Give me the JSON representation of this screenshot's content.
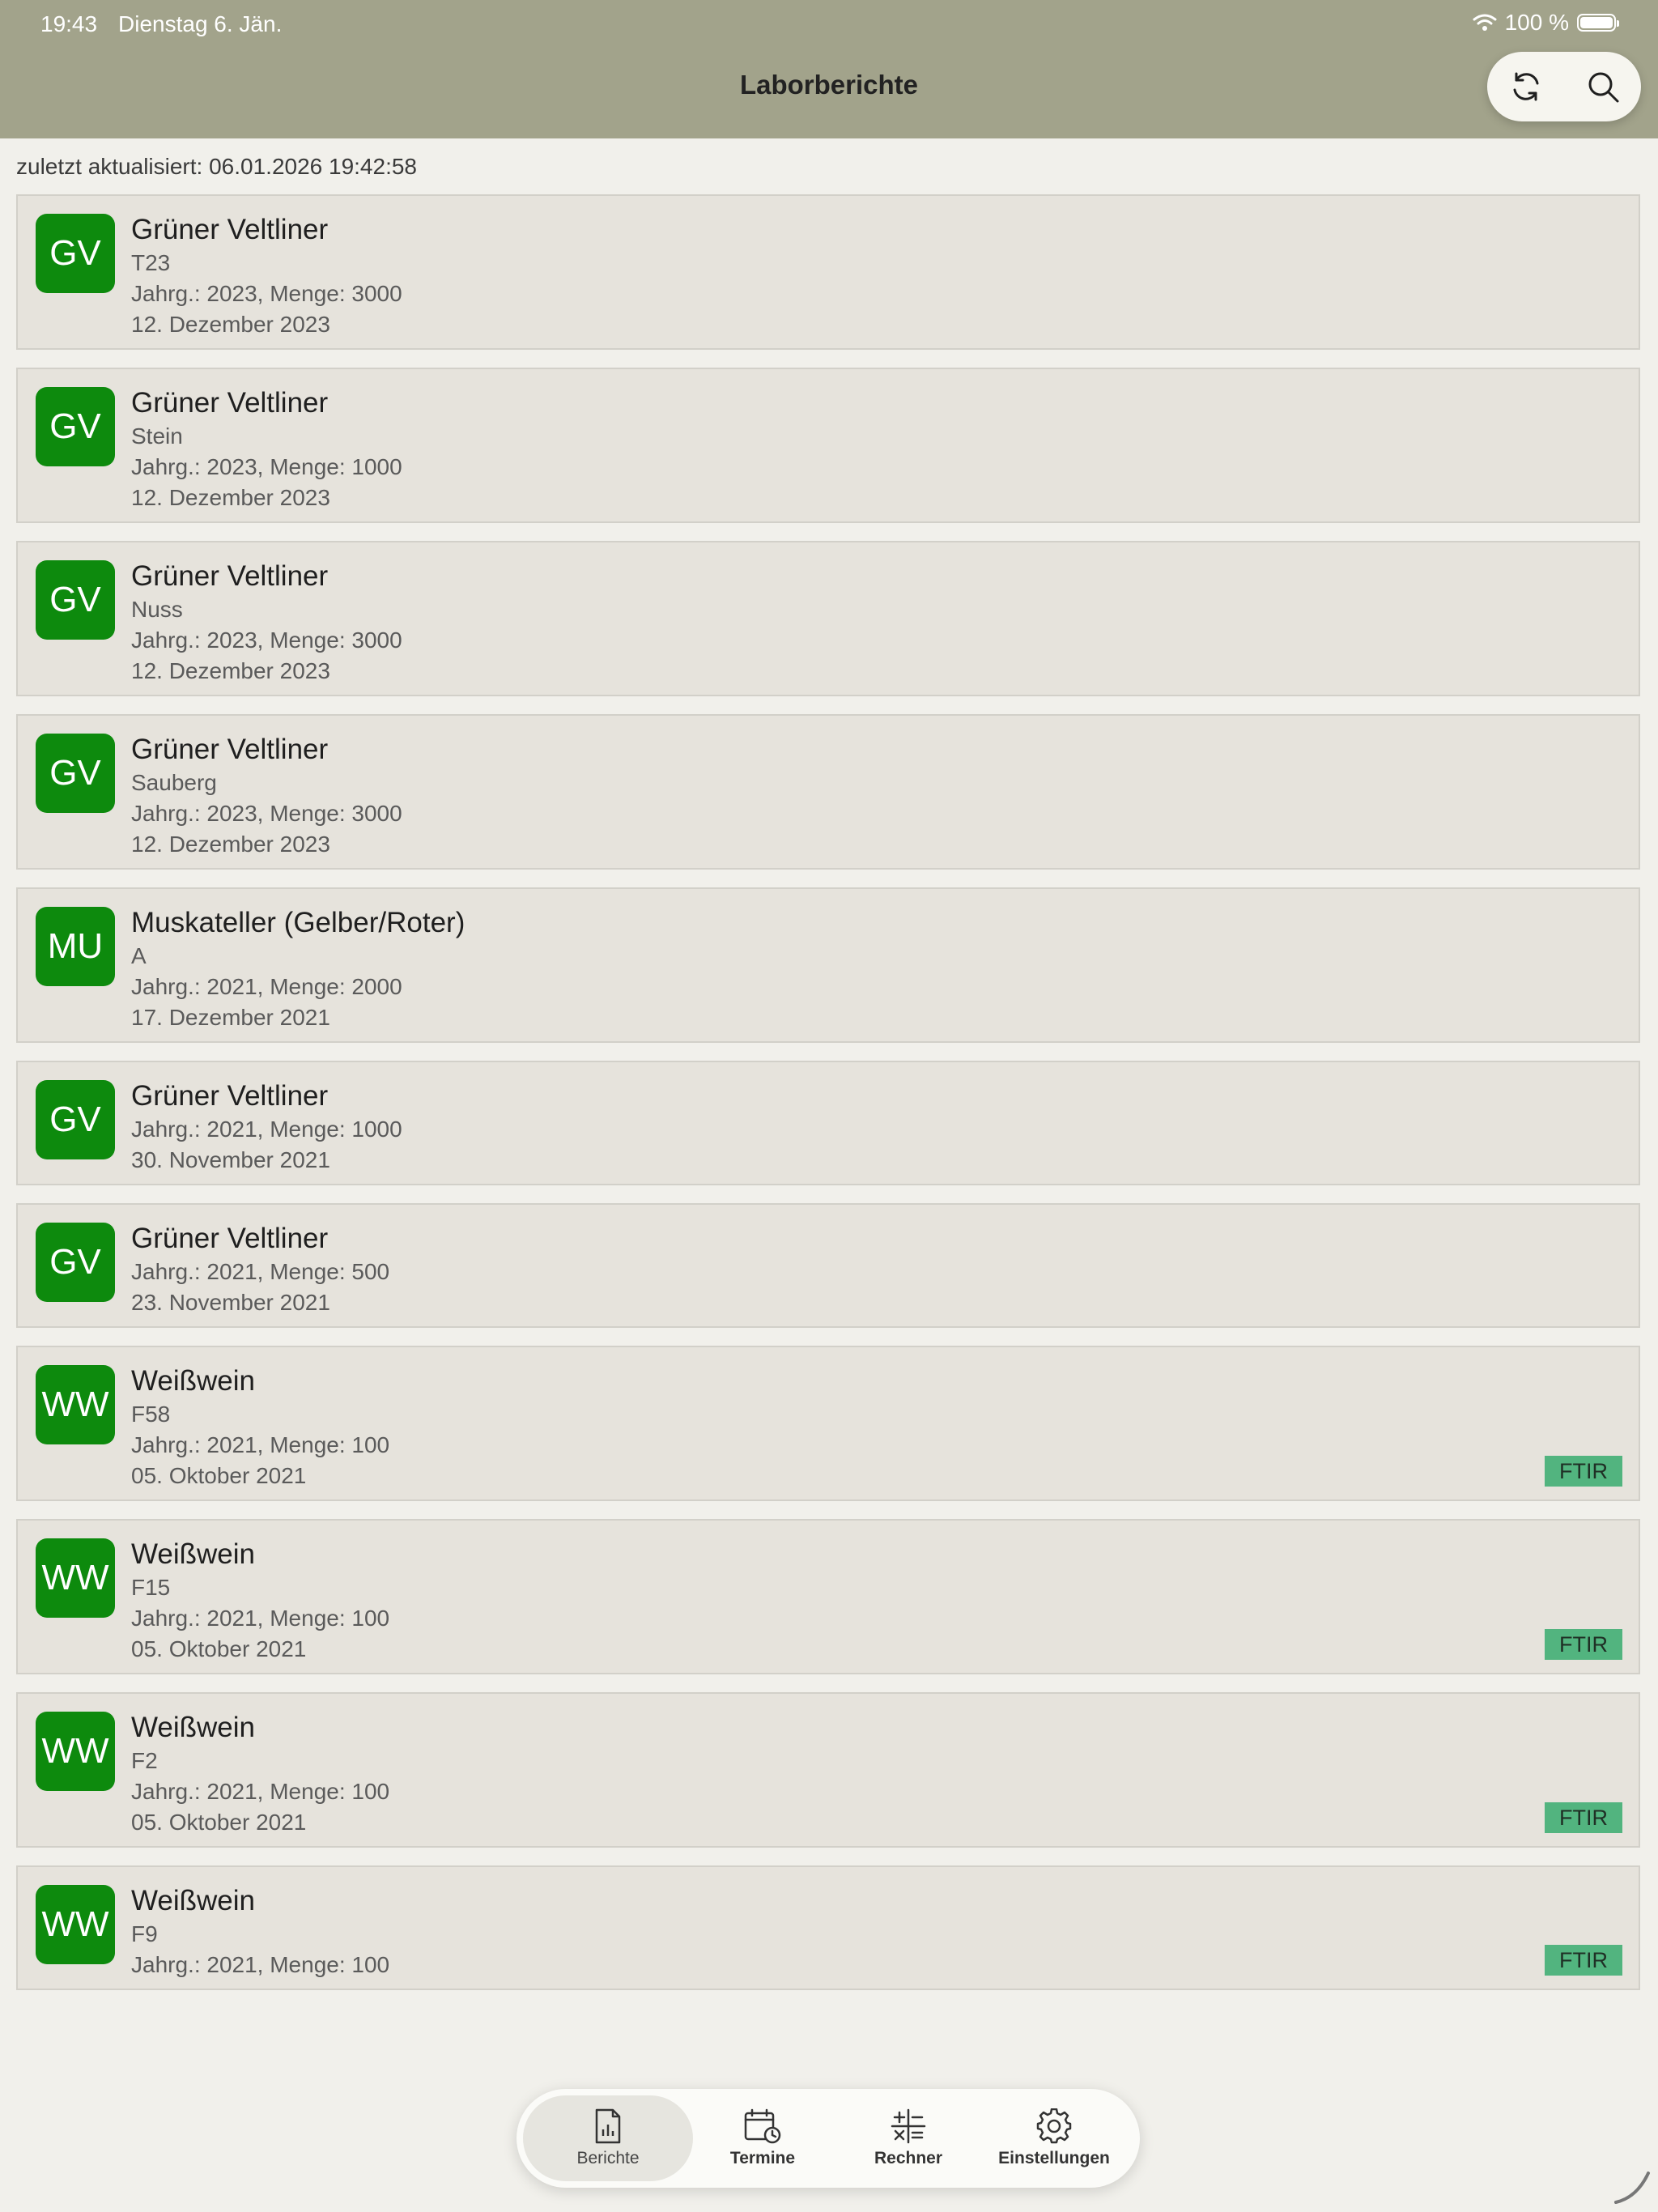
{
  "status": {
    "time": "19:43",
    "date": "Dienstag 6. Jän.",
    "battery": "100 %"
  },
  "header": {
    "title": "Laborberichte",
    "refresh_icon": "refresh-icon",
    "search_icon": "search-icon"
  },
  "last_updated": "zuletzt aktualisiert: 06.01.2026 19:42:58",
  "reports": [
    {
      "initials": "GV",
      "name": "Grüner Veltliner",
      "lines": [
        "T23",
        "Jahrg.: 2023, Menge: 3000",
        "12. Dezember 2023"
      ]
    },
    {
      "initials": "GV",
      "name": "Grüner Veltliner",
      "lines": [
        "Stein",
        "Jahrg.: 2023, Menge: 1000",
        "12. Dezember 2023"
      ]
    },
    {
      "initials": "GV",
      "name": "Grüner Veltliner",
      "lines": [
        "Nuss",
        "Jahrg.: 2023, Menge: 3000",
        "12. Dezember 2023"
      ]
    },
    {
      "initials": "GV",
      "name": "Grüner Veltliner",
      "lines": [
        "Sauberg",
        "Jahrg.: 2023, Menge: 3000",
        "12. Dezember 2023"
      ]
    },
    {
      "initials": "MU",
      "name": "Muskateller (Gelber/Roter)",
      "lines": [
        "A",
        "Jahrg.: 2021, Menge: 2000",
        "17. Dezember 2021"
      ]
    },
    {
      "initials": "GV",
      "name": "Grüner Veltliner",
      "lines": [
        "Jahrg.: 2021, Menge: 1000",
        "30. November 2021"
      ]
    },
    {
      "initials": "GV",
      "name": "Grüner Veltliner",
      "lines": [
        "Jahrg.: 2021, Menge: 500",
        "23. November 2021"
      ]
    },
    {
      "initials": "WW",
      "name": "Weißwein",
      "lines": [
        "F58",
        "Jahrg.: 2021, Menge: 100",
        "05. Oktober 2021"
      ],
      "tag": "FTIR"
    },
    {
      "initials": "WW",
      "name": "Weißwein",
      "lines": [
        "F15",
        "Jahrg.: 2021, Menge: 100",
        "05. Oktober 2021"
      ],
      "tag": "FTIR"
    },
    {
      "initials": "WW",
      "name": "Weißwein",
      "lines": [
        "F2",
        "Jahrg.: 2021, Menge: 100",
        "05. Oktober 2021"
      ],
      "tag": "FTIR"
    },
    {
      "initials": "WW",
      "name": "Weißwein",
      "lines": [
        "F9",
        "Jahrg.: 2021, Menge: 100"
      ],
      "tag": "FTIR"
    }
  ],
  "tabs": [
    {
      "label": "Berichte",
      "icon": "report-icon",
      "active": true
    },
    {
      "label": "Termine",
      "icon": "calendar-clock-icon",
      "active": false
    },
    {
      "label": "Rechner",
      "icon": "calculator-icon",
      "active": false
    },
    {
      "label": "Einstellungen",
      "icon": "gear-icon",
      "active": false
    }
  ],
  "colors": {
    "header": "#a2a38b",
    "avatar": "#0d8a0d",
    "tag": "#52b47f",
    "card": "#e6e3dc"
  }
}
